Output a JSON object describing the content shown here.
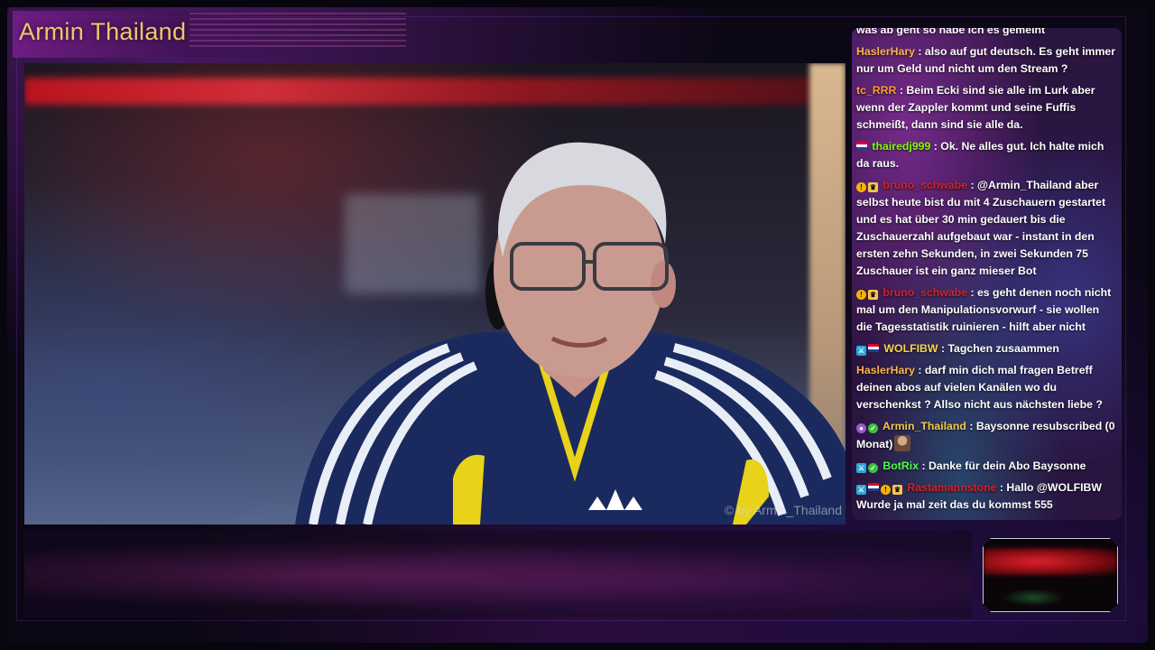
{
  "stream": {
    "title": "Armin Thailand",
    "watermark": "© by Armin_Thailand"
  },
  "colors": {
    "title": "#f3c56a",
    "user_hasler": "#ffb347",
    "user_tc": "#ff9b2f",
    "user_thairedj": "#7cfc00",
    "user_bruno": "#d0242a",
    "user_wolf": "#f7d64a",
    "user_armin": "#f7c64a",
    "user_botrix": "#4cff4c",
    "user_rasta": "#d0242a"
  },
  "chat": {
    "messages": [
      {
        "badges": [],
        "user": "",
        "text": "was ab geht so habe ich es gemeint"
      },
      {
        "badges": [],
        "user": "HaslerHary",
        "text": ": also auf gut deutsch. Es geht immer nur um Geld und nicht um den Stream ?"
      },
      {
        "badges": [],
        "user": "tc_RRR",
        "text": ": Beim Ecki sind sie alle im Lurk aber wenn der Zappler kommt und seine Fuffis schmeißt, dann sind sie alle da."
      },
      {
        "badges": [
          "flag-icon"
        ],
        "user": "thairedj999",
        "text": ": Ok. Ne alles gut. Ich halte mich da raus."
      },
      {
        "badges": [
          "vip-icon",
          "crown-icon"
        ],
        "user": "bruno_schwabe",
        "text": ": @Armin_Thailand aber selbst heute bist du mit 4 Zuschauern gestartet und es hat über 30 min gedauert bis die Zuschauerzahl aufgebaut war - instant in den ersten zehn Sekunden, in zwei Sekunden 75 Zuschauer ist ein ganz mieser Bot"
      },
      {
        "badges": [
          "vip-icon",
          "crown-icon"
        ],
        "user": "bruno_schwabe",
        "text": ": es geht denen noch nicht mal um den Manipulationsvorwurf - sie wollen die Tagesstatistik ruinieren - hilft aber nicht"
      },
      {
        "badges": [
          "mod-icon",
          "flag-icon"
        ],
        "user": "WOLFIBW",
        "text": ": Tagchen zusaammen"
      },
      {
        "badges": [],
        "user": "HaslerHary",
        "text": ": darf min dich mal fragen Betreff deinen abos auf vielen Kanälen wo du verschenkst ? Allso nicht aus nächsten liebe ?"
      },
      {
        "badges": [
          "mic-icon",
          "check-icon"
        ],
        "user": "Armin_Thailand",
        "text": ": Baysonne resubscribed (0 Monat)",
        "emote": true
      },
      {
        "badges": [
          "mod-icon",
          "check-icon"
        ],
        "user": "BotRix",
        "text": ": Danke für dein Abo Baysonne"
      },
      {
        "badges": [
          "mod-icon",
          "flag-icon",
          "vip-icon",
          "crown-icon"
        ],
        "user": "Rastamannstone",
        "text": ": Hallo @WOLFIBW Wurde ja mal zeit das du kommst 555"
      }
    ]
  }
}
